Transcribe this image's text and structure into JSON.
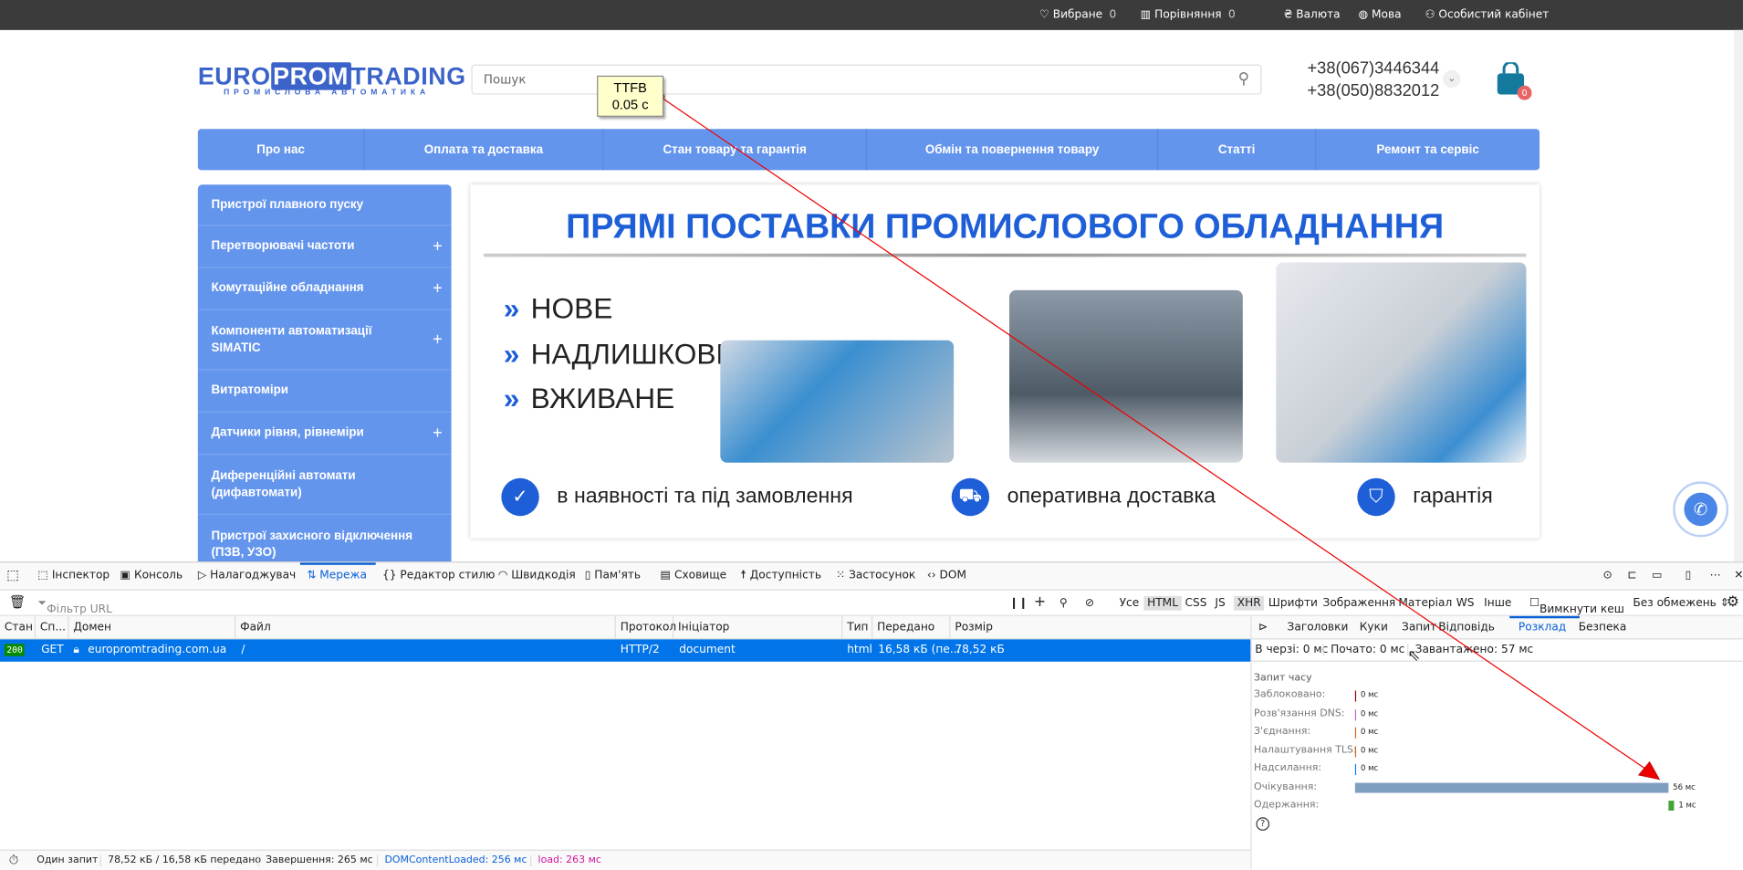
{
  "topbar": {
    "favorites": "Вибране",
    "favorites_count": "0",
    "compare": "Порівняння",
    "compare_count": "0",
    "currency": "Валюта",
    "language": "Мова",
    "account": "Особистий кабінет"
  },
  "header": {
    "logo_main_a": "EURO",
    "logo_main_b": "PROM",
    "logo_main_c": "TRADING",
    "logo_sub": "ПРОМИСЛОВА АВТОМАТИКА",
    "search_placeholder": "Пошук",
    "phone1": "+38(067)3446344",
    "phone2": "+38(050)8832012",
    "cart_count": "0"
  },
  "nav": [
    "Про нас",
    "Оплата та доставка",
    "Стан товару та гарантія",
    "Обмін та повернення товару",
    "Статті",
    "Ремонт та сервіс"
  ],
  "sidebar": [
    {
      "label": "Пристрої плавного пуску",
      "plus": ""
    },
    {
      "label": "Перетворювачі частоти",
      "plus": "+"
    },
    {
      "label": "Комутаційне обладнання",
      "plus": "+"
    },
    {
      "label": "Компоненти автоматизації SIMATIC",
      "plus": "+"
    },
    {
      "label": "Витратоміри",
      "plus": ""
    },
    {
      "label": "Датчики рівня, рівнеміри",
      "plus": "+"
    },
    {
      "label": "Диференційні автомати (дифавтомати)",
      "plus": ""
    },
    {
      "label": "Пристрої захисного відключення (ПЗВ, УЗО)",
      "plus": ""
    }
  ],
  "banner": {
    "title": "ПРЯМІ ПОСТАВКИ ПРОМИСЛОВОГО ОБЛАДНАННЯ",
    "bullets": [
      "НОВЕ",
      "НАДЛИШКОВЕ",
      "ВЖИВАНЕ"
    ],
    "features": [
      "в наявності та під замовлення",
      "оперативна доставка",
      "гарантія"
    ]
  },
  "tooltip": {
    "label": "TTFB",
    "value": "0.05 с"
  },
  "devtools": {
    "tabs": [
      "Інспектор",
      "Консоль",
      "Налагоджувач",
      "Мережа",
      "Редактор стилю",
      "Швидкодія",
      "Пам'ять",
      "Сховище",
      "Доступність",
      "Застосунок",
      "DOM"
    ],
    "filter_placeholder": "Фільтр URL",
    "type_filters": [
      "Усе",
      "HTML",
      "CSS",
      "JS",
      "XHR",
      "Шрифти",
      "Зображення",
      "Матеріал",
      "WS",
      "Інше"
    ],
    "disable_cache": "Вимкнути кеш",
    "throttle": "Без обмежень ⇕",
    "columns": [
      "Стан",
      "Сп...",
      "Домен",
      "Файл",
      "Протокол",
      "Ініціатор",
      "Тип",
      "Передано",
      "Розмір"
    ],
    "request": {
      "status": "200",
      "method": "GET",
      "domain": "europromtrading.com.ua",
      "file": "/",
      "protocol": "HTTP/2",
      "initiator": "document",
      "type": "html",
      "transferred": "16,58 кБ (пе...",
      "size": "78,52 кБ"
    },
    "detail_tabs": [
      "Заголовки",
      "Куки",
      "Запит",
      "Відповідь",
      "Розклад",
      "Безпека"
    ],
    "summary": {
      "queued": "В черзі: 0 мс",
      "started": "Почато: 0 мс",
      "downloaded": "Завантажено: 57 мс"
    },
    "timing_title": "Запит часу",
    "timings": [
      {
        "label": "Заблоковано:",
        "value": "0 мс",
        "color": "#a4000f",
        "ms": 0
      },
      {
        "label": "Розв'язання DNS:",
        "value": "0 мс",
        "color": "#c069c6",
        "ms": 0
      },
      {
        "label": "З'єднання:",
        "value": "0 мс",
        "color": "#d7661b",
        "ms": 0
      },
      {
        "label": "Налаштування TLS:",
        "value": "0 мс",
        "color": "#d7661b",
        "ms": 0
      },
      {
        "label": "Надсилання:",
        "value": "0 мс",
        "color": "#0a84ff",
        "ms": 0
      },
      {
        "label": "Очікування:",
        "value": "56 мс",
        "color": "#7f9fc0",
        "ms": 56
      },
      {
        "label": "Одержання:",
        "value": "1 мс",
        "color": "#45a33a",
        "ms": 1
      }
    ],
    "status": {
      "requests": "Один запит",
      "transferred": "78,52 кБ / 16,58 кБ передано",
      "finish": "Завершення: 265 мс",
      "dcl": "DOMContentLoaded: 256 мс",
      "load": "load: 263 мс"
    }
  }
}
